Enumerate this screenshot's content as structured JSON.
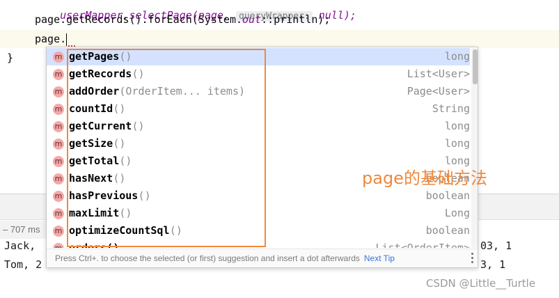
{
  "editor": {
    "line1_code": "userMapper.selectPage(page,",
    "line1_hint": "queryWrapper:",
    "line1_tail": "null);",
    "line2_prefix": "page.getRecords().forEach(System.",
    "line2_out": "out",
    "line2_suffix": "::println);",
    "line3_text": "page.",
    "line4_brace": "}"
  },
  "tool_window": {
    "time_badge": "– 707 ms"
  },
  "console": {
    "line1_left": "Jack,",
    "line1_right": "03, 1",
    "line2_left": "Tom, 2",
    "line2_right": "3, 1",
    "partial_item": "orders()",
    "partial_type": "List<OrderItem>"
  },
  "completion": {
    "icon_letter": "m",
    "items": [
      {
        "name": "getPages",
        "params": "()",
        "type": "long",
        "selected": true
      },
      {
        "name": "getRecords",
        "params": "()",
        "type": "List<User>"
      },
      {
        "name": "addOrder",
        "params": "(OrderItem... items)",
        "type": "Page<User>"
      },
      {
        "name": "countId",
        "params": "()",
        "type": "String"
      },
      {
        "name": "getCurrent",
        "params": "()",
        "type": "long"
      },
      {
        "name": "getSize",
        "params": "()",
        "type": "long"
      },
      {
        "name": "getTotal",
        "params": "()",
        "type": "long"
      },
      {
        "name": "hasNext",
        "params": "()",
        "type": "boolean"
      },
      {
        "name": "hasPrevious",
        "params": "()",
        "type": "boolean"
      },
      {
        "name": "maxLimit",
        "params": "()",
        "type": "Long"
      },
      {
        "name": "optimizeCountSql",
        "params": "()",
        "type": "boolean"
      }
    ],
    "footer_text": "Press Ctrl+. to choose the selected (or first) suggestion and insert a dot afterwards",
    "next_tip": "Next Tip"
  },
  "annotation": {
    "label": "page的基础方法",
    "color": "#f0883c"
  },
  "watermark": "CSDN @Little__Turtle"
}
